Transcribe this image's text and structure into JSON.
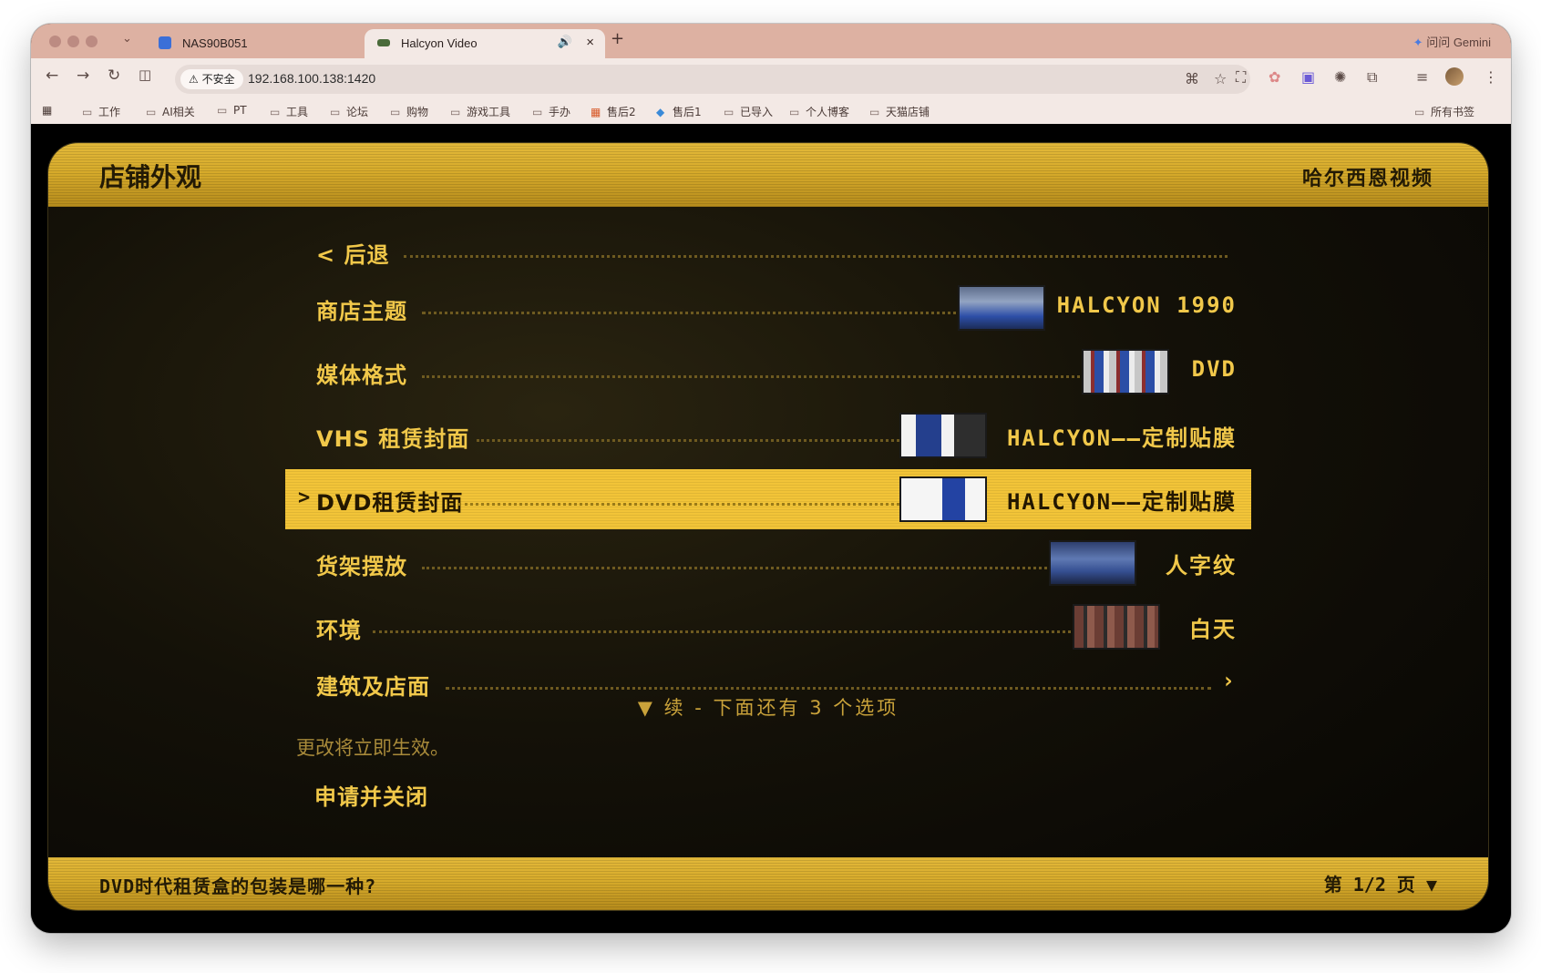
{
  "browser": {
    "tabs": [
      {
        "title": "NAS90B051",
        "favicon_color": "#3b6fd8",
        "active": false
      },
      {
        "title": "Halcyon Video",
        "favicon_color": "#4a6b3a",
        "active": true
      }
    ],
    "new_tab_symbol": "+",
    "gemini_label": "问问 Gemini",
    "security_label": "不安全",
    "url": "192.168.100.138:1420",
    "bookmarks": [
      "工作",
      "AI相关",
      "PT",
      "工具",
      "论坛",
      "购物",
      "游戏工具",
      "手办",
      "售后2",
      "售后1",
      "已导入",
      "个人博客",
      "天猫店铺"
    ],
    "all_bookmarks": "所有书签"
  },
  "game": {
    "header_title": "店铺外观",
    "header_brand": "哈尔西恩视频",
    "back_label": "< 后退",
    "menu": [
      {
        "label": "商店主题",
        "value": "HALCYON 1990",
        "thumb": "store"
      },
      {
        "label": "媒体格式",
        "value": "DVD",
        "thumb": "dvd"
      },
      {
        "label": "VHS 租赁封面",
        "value": "HALCYON——定制贴膜",
        "thumb": "vhs"
      },
      {
        "label": "DVD租赁封面",
        "value": "HALCYON——定制贴膜",
        "thumb": "dvd2",
        "selected": true
      },
      {
        "label": "货架摆放",
        "value": "人字纹",
        "thumb": "shelf"
      },
      {
        "label": "环境",
        "value": "白天",
        "thumb": "env"
      },
      {
        "label": "建筑及店面",
        "value": "›"
      }
    ],
    "selection_cursor": ">",
    "more_indicator": "▼ 续 - 下面还有 3 个选项",
    "hint": "更改将立即生效。",
    "apply_close": "申请并关闭",
    "footer_question": "DVD时代租赁盒的包装是哪一种?",
    "footer_page": "第 1/2 页 ▼"
  },
  "colors": {
    "accent_gold": "#e3b93a",
    "menu_text": "#f1c84a",
    "dark_bg": "#000000"
  }
}
